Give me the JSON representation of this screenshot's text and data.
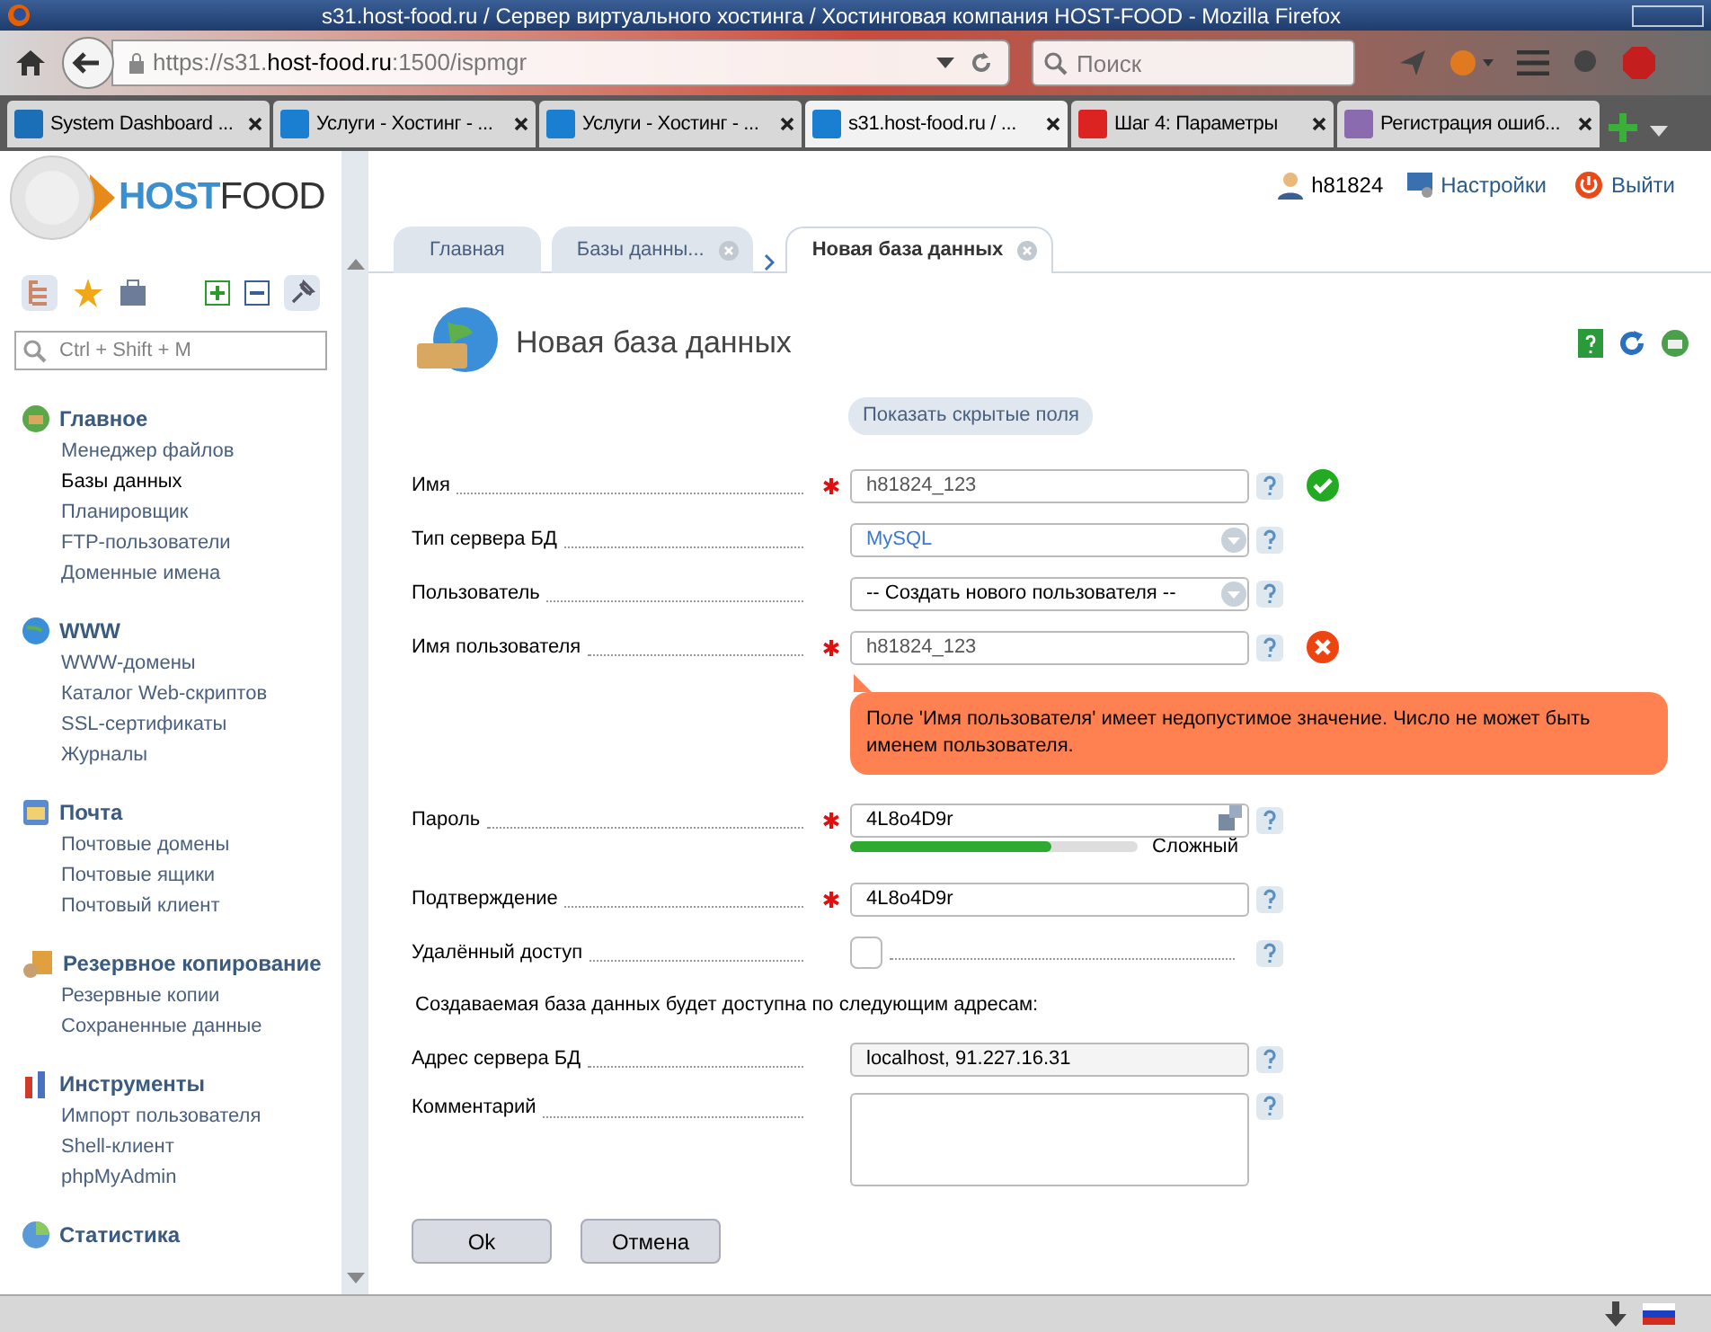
{
  "window": {
    "title": "s31.host-food.ru / Сервер виртуального хостинга / Хостинговая компания HOST-FOOD - Mozilla Firefox"
  },
  "toolbar": {
    "url_prefix": "https://s31.",
    "url_host": "host-food.ru",
    "url_rest": ":1500/ispmgr",
    "search_placeholder": "Поиск"
  },
  "browser_tabs": [
    {
      "label": "System Dashboard ...",
      "selected": false
    },
    {
      "label": "Услуги - Хостинг - ...",
      "selected": false
    },
    {
      "label": "Услуги - Хостинг - ...",
      "selected": false
    },
    {
      "label": "s31.host-food.ru / ...",
      "selected": true
    },
    {
      "label": "Шаг 4: Параметры",
      "selected": false
    },
    {
      "label": "Регистрация ошиб...",
      "selected": false
    }
  ],
  "header": {
    "logo_bold": "HOST",
    "logo_rest": "FOOD",
    "user": "h81824",
    "links": [
      "Настройки",
      "Выйти"
    ]
  },
  "app_tabs": [
    {
      "label": "Главная",
      "selected": false,
      "closable": false
    },
    {
      "label": "Базы данны...",
      "selected": false,
      "closable": true
    },
    {
      "label": "Новая база данных",
      "selected": true,
      "closable": true
    }
  ],
  "sidebar": {
    "search_placeholder": "Ctrl + Shift + M",
    "groups": [
      {
        "title": "Главное",
        "items": [
          {
            "label": "Менеджер файлов",
            "selected": false
          },
          {
            "label": "Базы данных",
            "selected": true
          },
          {
            "label": "Планировщик",
            "selected": false
          },
          {
            "label": "FTP-пользователи",
            "selected": false
          },
          {
            "label": "Доменные имена",
            "selected": false
          }
        ]
      },
      {
        "title": "WWW",
        "items": [
          {
            "label": "WWW-домены",
            "selected": false
          },
          {
            "label": "Каталог Web-скриптов",
            "selected": false
          },
          {
            "label": "SSL-сертификаты",
            "selected": false
          },
          {
            "label": "Журналы",
            "selected": false
          }
        ]
      },
      {
        "title": "Почта",
        "items": [
          {
            "label": "Почтовые домены",
            "selected": false
          },
          {
            "label": "Почтовые ящики",
            "selected": false
          },
          {
            "label": "Почтовый клиент",
            "selected": false
          }
        ]
      },
      {
        "title": "Резервное копирование",
        "items": [
          {
            "label": "Резервные копии",
            "selected": false
          },
          {
            "label": "Сохраненные данные",
            "selected": false
          }
        ]
      },
      {
        "title": "Инструменты",
        "items": [
          {
            "label": "Импорт пользователя",
            "selected": false
          },
          {
            "label": "Shell-клиент",
            "selected": false
          },
          {
            "label": "phpMyAdmin",
            "selected": false
          }
        ]
      },
      {
        "title": "Статистика"
      }
    ]
  },
  "form": {
    "title": "Новая база данных",
    "show_hidden": "Показать скрытые поля",
    "rows": [
      {
        "kind": "text",
        "label": "Имя",
        "required": true,
        "value": "h81824_123",
        "valid": true
      },
      {
        "kind": "select",
        "label": "Тип сервера БД",
        "required": false,
        "value": "MySQL"
      },
      {
        "kind": "select",
        "label": "Пользователь",
        "required": false,
        "value": "-- Создать нового пользователя --"
      },
      {
        "kind": "text",
        "label": "Имя пользователя",
        "required": true,
        "value": "h81824_123",
        "valid": false,
        "error": "Поле 'Имя пользователя' имеет недопустимое значение. Число не может быть именем пользователя."
      },
      {
        "kind": "password",
        "label": "Пароль",
        "required": true,
        "value": "4L8o4D9r",
        "strength": {
          "level": 0.7,
          "label": "Сложный"
        }
      },
      {
        "kind": "text",
        "label": "Подтверждение",
        "required": true,
        "value": "4L8o4D9r"
      },
      {
        "kind": "checkbox",
        "label": "Удалённый доступ",
        "required": false,
        "checked": false
      },
      {
        "kind": "note",
        "label": "Создаваемая база данных будет доступна по следующим адресам:"
      },
      {
        "kind": "readonly",
        "label": "Адрес сервера БД",
        "required": false,
        "value": "localhost, 91.227.16.31"
      },
      {
        "kind": "textarea",
        "label": "Комментарий",
        "required": false,
        "value": ""
      }
    ],
    "buttons": [
      "Ok",
      "Отмена"
    ]
  }
}
